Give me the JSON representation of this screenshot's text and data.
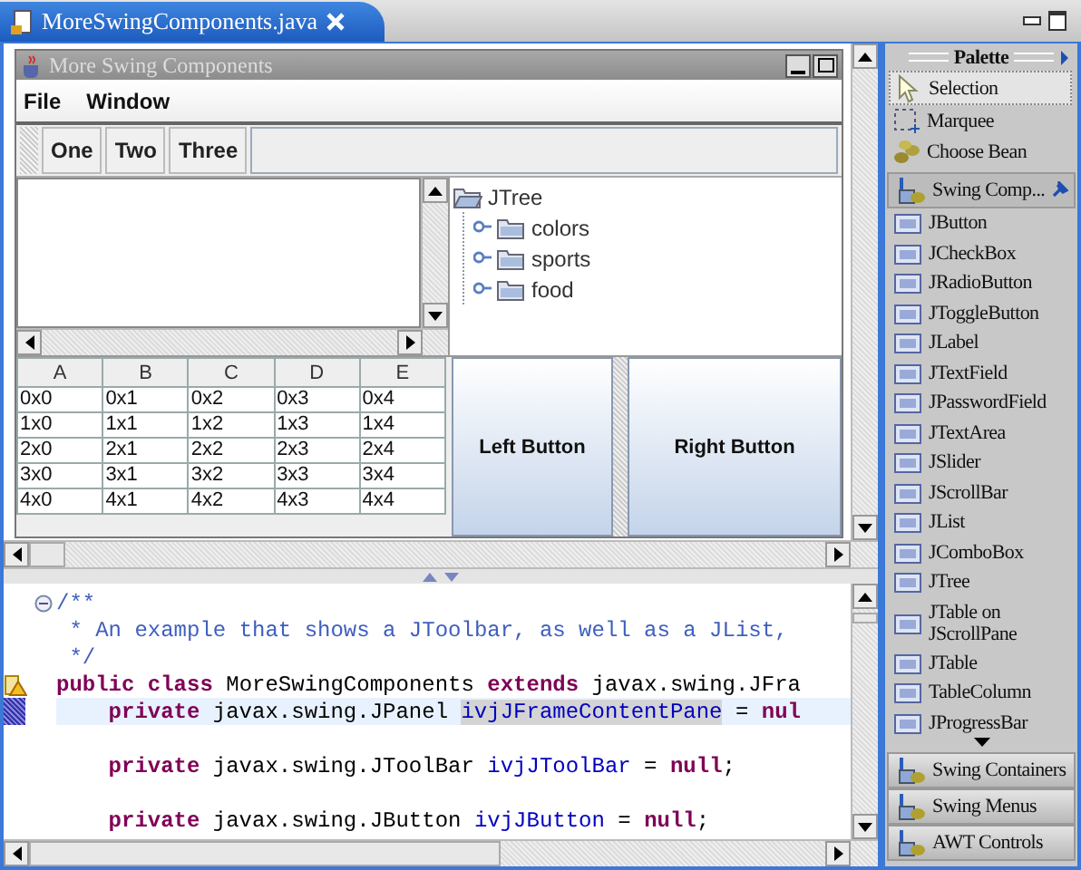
{
  "editor_tab": {
    "title": "MoreSwingComponents.java"
  },
  "swing_frame": {
    "title": "More Swing Components",
    "menu": [
      "File",
      "Window"
    ],
    "toolbar": [
      "One",
      "Two",
      "Three"
    ],
    "tree": {
      "label": "JTree",
      "expanded": true,
      "children": [
        {
          "label": "colors",
          "expanded": false
        },
        {
          "label": "sports",
          "expanded": false
        },
        {
          "label": "food",
          "expanded": false
        }
      ]
    },
    "table": {
      "columns": [
        "A",
        "B",
        "C",
        "D",
        "E"
      ],
      "rows": [
        [
          "0x0",
          "0x1",
          "0x2",
          "0x3",
          "0x4"
        ],
        [
          "1x0",
          "1x1",
          "1x2",
          "1x3",
          "1x4"
        ],
        [
          "2x0",
          "2x1",
          "2x2",
          "2x3",
          "2x4"
        ],
        [
          "3x0",
          "3x1",
          "3x2",
          "3x3",
          "3x4"
        ],
        [
          "4x0",
          "4x1",
          "4x2",
          "4x3",
          "4x4"
        ]
      ]
    },
    "buttons": [
      "Left Button",
      "Right Button"
    ]
  },
  "code": {
    "lines": [
      {
        "kind": "code",
        "expanded": true,
        "tokens": [
          {
            "kind": "comment",
            "text": "/**"
          }
        ]
      },
      {
        "kind": "code",
        "tokens": [
          {
            "kind": "comment",
            "text": " * An example that shows a JToolbar, as well as a JList,"
          }
        ]
      },
      {
        "kind": "code",
        "tokens": [
          {
            "kind": "comment",
            "text": " */"
          }
        ]
      },
      {
        "kind": "code",
        "warning": true,
        "tokens": [
          {
            "kind": "keyword",
            "text": "public class "
          },
          {
            "kind": "plain",
            "text": "MoreSwingComponents "
          },
          {
            "kind": "keyword",
            "text": "extends "
          },
          {
            "kind": "plain",
            "text": "javax.swing.JFra"
          }
        ]
      },
      {
        "kind": "member",
        "marked": true,
        "current": true,
        "tokens": [
          {
            "kind": "keyword",
            "text": "private "
          },
          {
            "kind": "plain",
            "text": "javax.swing.JPanel "
          },
          {
            "kind": "occurrence",
            "text": "ivjJFrameContentPane"
          },
          {
            "kind": "plain",
            "text": " = "
          },
          {
            "kind": "keyword",
            "text": "nul"
          }
        ]
      },
      {
        "kind": "blank"
      },
      {
        "kind": "member",
        "tokens": [
          {
            "kind": "keyword",
            "text": "private "
          },
          {
            "kind": "plain",
            "text": "javax.swing.JToolBar "
          },
          {
            "kind": "field",
            "text": "ivjJToolBar"
          },
          {
            "kind": "plain",
            "text": " = "
          },
          {
            "kind": "keyword",
            "text": "null"
          },
          {
            "kind": "plain",
            "text": ";"
          }
        ]
      },
      {
        "kind": "blank"
      },
      {
        "kind": "member",
        "tokens": [
          {
            "kind": "keyword",
            "text": "private "
          },
          {
            "kind": "plain",
            "text": "javax.swing.JButton "
          },
          {
            "kind": "field",
            "text": "ivjJButton"
          },
          {
            "kind": "plain",
            "text": " = "
          },
          {
            "kind": "keyword",
            "text": "null"
          },
          {
            "kind": "plain",
            "text": ";"
          }
        ]
      }
    ]
  },
  "palette": {
    "title": "Palette",
    "tools": [
      {
        "label": "Selection",
        "selected": true
      },
      {
        "label": "Marquee",
        "selected": false
      },
      {
        "label": "Choose Bean",
        "selected": false
      }
    ],
    "drawers": [
      {
        "label": "Swing Comp...",
        "expanded": true,
        "items": [
          "JButton",
          "JCheckBox",
          "JRadioButton",
          "JToggleButton",
          "JLabel",
          "JTextField",
          "JPasswordField",
          "JTextArea",
          "JSlider",
          "JScrollBar",
          "JList",
          "JComboBox",
          "JTree",
          "JTable on JScrollPane",
          "JTable",
          "TableColumn",
          "JProgressBar"
        ]
      },
      {
        "label": "Swing Containers",
        "expanded": false
      },
      {
        "label": "Swing Menus",
        "expanded": false
      },
      {
        "label": "AWT Controls",
        "expanded": false
      }
    ]
  }
}
